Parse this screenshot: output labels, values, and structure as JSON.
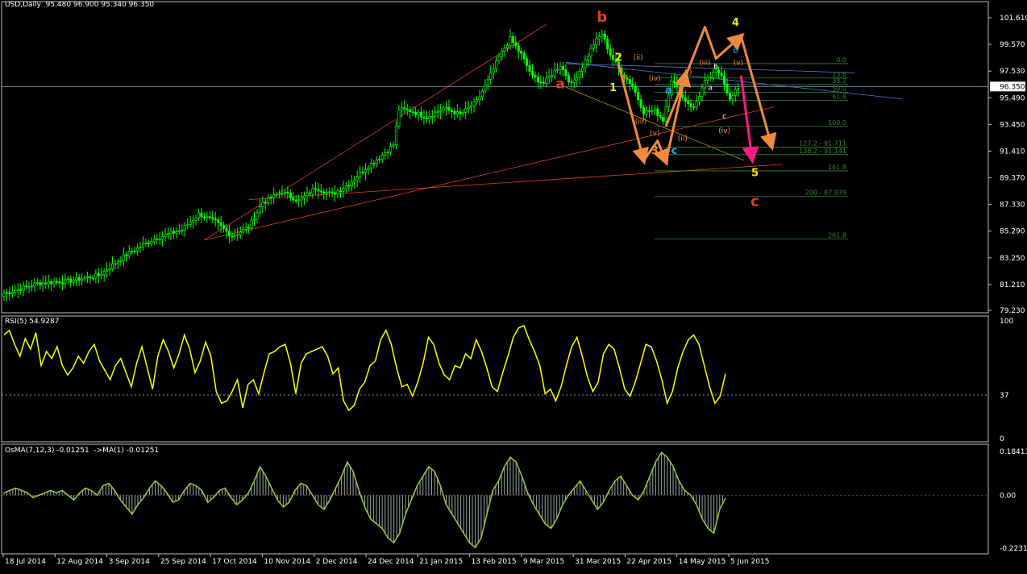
{
  "window": {
    "symbol_timeframe": "USD,Daily",
    "ohlc": "95.480 96.900 95.340 96.350"
  },
  "colors": {
    "background": "#000000",
    "candle": "#00ff00",
    "frame": "#c0c0c0",
    "grid_text": "#ffffff",
    "price_line": "#6b7fb5",
    "trend_red": "#e0401a",
    "trend_blue": "#5b78d8",
    "wave_orange": "#f08a3c",
    "wave_yellow": "#ffe600",
    "wave_cyan": "#29a9e0",
    "wave_pink": "#ff1a8c",
    "fib": "#2e8b2e",
    "rsi": "#ffff00",
    "osma_bar": "#9aa6a6",
    "osma_line": "#9acd32"
  },
  "chart_data": [
    {
      "type": "candlestick",
      "panel": "price",
      "title": "USD,Daily",
      "ylim": [
        79.23,
        101.61
      ],
      "price_axis": [
        "101.610",
        "99.570",
        "97.530",
        "95.490",
        "93.450",
        "91.410",
        "89.370",
        "87.330",
        "85.290",
        "83.250",
        "81.210",
        "79.230"
      ],
      "current_price": "96.350",
      "x_dates": [
        "18 Jul 2014",
        "12 Aug 2014",
        "3 Sep 2014",
        "25 Sep 2014",
        "17 Oct 2014",
        "10 Nov 2014",
        "2 Dec 2014",
        "24 Dec 2014",
        "21 Jan 2015",
        "13 Feb 2015",
        "9 Mar 2015",
        "31 Mar 2015",
        "22 Apr 2015",
        "14 May 2015",
        "5 Jun 2015"
      ],
      "close_path": [
        [
          0,
          80.5
        ],
        [
          12,
          81.3
        ],
        [
          24,
          81.5
        ],
        [
          34,
          81.9
        ],
        [
          44,
          83.5
        ],
        [
          54,
          84.7
        ],
        [
          64,
          85.4
        ],
        [
          70,
          86.6
        ],
        [
          76,
          86.0
        ],
        [
          82,
          84.9
        ],
        [
          88,
          85.6
        ],
        [
          93,
          87.5
        ],
        [
          100,
          88.3
        ],
        [
          106,
          87.6
        ],
        [
          112,
          88.6
        ],
        [
          118,
          88.1
        ],
        [
          124,
          88.9
        ],
        [
          130,
          90.1
        ],
        [
          136,
          91.1
        ],
        [
          140,
          91.9
        ],
        [
          142,
          94.6
        ],
        [
          146,
          94.5
        ],
        [
          152,
          94.0
        ],
        [
          158,
          94.7
        ],
        [
          164,
          94.2
        ],
        [
          170,
          95.2
        ],
        [
          174,
          96.8
        ],
        [
          178,
          98.6
        ],
        [
          182,
          100.0
        ],
        [
          186,
          98.8
        ],
        [
          190,
          97.1
        ],
        [
          194,
          96.6
        ],
        [
          200,
          98.0
        ],
        [
          204,
          96.5
        ],
        [
          208,
          97.9
        ],
        [
          212,
          99.6
        ],
        [
          215,
          100.4
        ],
        [
          218,
          98.8
        ],
        [
          222,
          97.4
        ],
        [
          226,
          96.4
        ],
        [
          230,
          94.4
        ],
        [
          234,
          94.5
        ],
        [
          237,
          93.8
        ],
        [
          240,
          96.9
        ],
        [
          244,
          95.5
        ],
        [
          248,
          94.7
        ],
        [
          252,
          96.7
        ],
        [
          256,
          97.5
        ],
        [
          258,
          97.3
        ],
        [
          261,
          95.3
        ],
        [
          264,
          96.3
        ]
      ],
      "annotations": [
        {
          "text": "a",
          "color": "orange-red"
        },
        {
          "text": "b",
          "color": "orange-red"
        },
        {
          "text": "c",
          "color": "orange-red"
        },
        {
          "text": "1",
          "color": "yellow"
        },
        {
          "text": "2",
          "color": "yellow"
        },
        {
          "text": "3",
          "color": "orange"
        },
        {
          "text": "4",
          "color": "yellow"
        },
        {
          "text": "5",
          "color": "yellow"
        },
        {
          "text": "a",
          "color": "cyan"
        },
        {
          "text": "b",
          "color": "cyan"
        },
        {
          "text": "c",
          "color": "cyan"
        },
        {
          "text": "(i)",
          "color": "orange"
        },
        {
          "text": "(ii)",
          "color": "orange"
        },
        {
          "text": "(iii)",
          "color": "orange"
        },
        {
          "text": "(iv)",
          "color": "orange"
        },
        {
          "text": "(v)",
          "color": "orange"
        },
        {
          "text": "(i)",
          "color": "orange"
        },
        {
          "text": "(ii)",
          "color": "orange"
        },
        {
          "text": "(iii)",
          "color": "orange"
        },
        {
          "text": "(iv)",
          "color": "orange"
        },
        {
          "text": "(v)",
          "color": "orange"
        },
        {
          "text": "a",
          "color": "white"
        },
        {
          "text": "b",
          "color": "white"
        },
        {
          "text": "c",
          "color": "white"
        }
      ],
      "fibonacci_levels": [
        "0.0",
        "23.6",
        "38.2",
        "50.0",
        "61.8",
        "100.0",
        "127.2 - 91.711",
        "138.2 - 91.141",
        "161.8",
        "200 - 87.939",
        "261.8"
      ],
      "fibonacci_values": [
        98.1,
        97.0,
        96.5,
        95.9,
        95.3,
        93.3,
        91.711,
        91.141,
        89.9,
        87.939,
        84.7
      ]
    },
    {
      "type": "line",
      "panel": "rsi",
      "title": "RSI(5) 54.9287",
      "ylim": [
        0,
        100
      ],
      "levels": [
        "100",
        "37",
        "0"
      ],
      "values": [
        88,
        92,
        80,
        70,
        85,
        76,
        90,
        62,
        74,
        68,
        78,
        62,
        54,
        60,
        70,
        64,
        74,
        80,
        66,
        58,
        50,
        62,
        68,
        56,
        44,
        64,
        78,
        60,
        42,
        70,
        84,
        74,
        60,
        72,
        88,
        76,
        56,
        66,
        82,
        70,
        40,
        30,
        32,
        40,
        50,
        26,
        46,
        50,
        38,
        56,
        72,
        74,
        78,
        80,
        64,
        38,
        64,
        72,
        74,
        76,
        78,
        70,
        55,
        60,
        32,
        24,
        28,
        42,
        48,
        62,
        66,
        84,
        92,
        80,
        60,
        44,
        46,
        36,
        48,
        64,
        86,
        80,
        64,
        54,
        50,
        62,
        60,
        72,
        68,
        84,
        74,
        60,
        44,
        40,
        56,
        70,
        86,
        94,
        96,
        84,
        74,
        62,
        38,
        42,
        32,
        44,
        62,
        78,
        86,
        70,
        52,
        40,
        48,
        72,
        80,
        76,
        60,
        42,
        36,
        48,
        64,
        80,
        78,
        66,
        50,
        30,
        40,
        60,
        74,
        84,
        88,
        80,
        62,
        44,
        30,
        36,
        55
      ]
    },
    {
      "type": "bar",
      "panel": "osma",
      "title": "OsMA(7,12,3) -0.01251  ->MA(1) -0.01251",
      "ylim": [
        -0.22312,
        0.18413
      ],
      "levels": [
        "0.18413",
        "0.00",
        "-0.22312"
      ],
      "values": [
        0.01,
        0.02,
        0.03,
        0.02,
        0.01,
        -0.01,
        0.0,
        0.01,
        0.02,
        0.01,
        0.02,
        0.0,
        -0.02,
        0.01,
        0.03,
        0.02,
        0.0,
        0.04,
        0.05,
        0.02,
        -0.02,
        -0.05,
        -0.08,
        -0.04,
        -0.01,
        0.03,
        0.06,
        0.04,
        0.01,
        -0.03,
        -0.02,
        0.02,
        0.05,
        0.04,
        0.02,
        -0.03,
        -0.01,
        0.02,
        0.03,
        -0.01,
        -0.04,
        -0.02,
        0.01,
        0.06,
        0.12,
        0.08,
        0.03,
        -0.02,
        -0.05,
        -0.03,
        0.02,
        0.05,
        0.04,
        0.0,
        -0.04,
        -0.06,
        -0.02,
        0.03,
        0.08,
        0.14,
        0.1,
        0.02,
        -0.05,
        -0.1,
        -0.12,
        -0.14,
        -0.18,
        -0.2,
        -0.16,
        -0.08,
        -0.02,
        0.04,
        0.08,
        0.12,
        0.1,
        0.04,
        -0.04,
        -0.08,
        -0.12,
        -0.16,
        -0.2,
        -0.22,
        -0.18,
        -0.08,
        0.02,
        0.06,
        0.12,
        0.16,
        0.14,
        0.08,
        0.01,
        -0.04,
        -0.08,
        -0.12,
        -0.14,
        -0.1,
        -0.04,
        0.0,
        0.03,
        0.06,
        0.02,
        -0.02,
        -0.06,
        -0.03,
        0.02,
        0.06,
        0.08,
        0.04,
        0.0,
        -0.02,
        0.02,
        0.08,
        0.14,
        0.18,
        0.16,
        0.12,
        0.06,
        0.02,
        0.0,
        -0.04,
        -0.1,
        -0.14,
        -0.16,
        -0.06,
        -0.013
      ]
    }
  ]
}
